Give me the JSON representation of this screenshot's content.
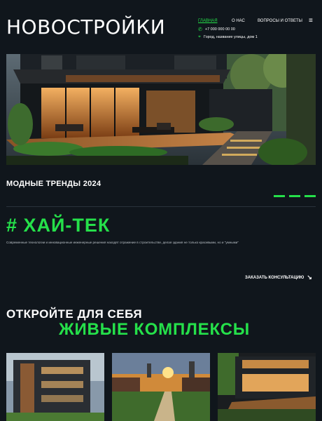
{
  "header": {
    "logo": "НОВОСТРОЙКИ",
    "nav": [
      {
        "label": "ГЛАВНАЯ",
        "active": true
      },
      {
        "label": "О НАС",
        "active": false
      },
      {
        "label": "ВОПРОСЫ И ОТВЕТЫ",
        "active": false
      }
    ],
    "menu_icon": "≡",
    "phone": "+7 000 000 00 00",
    "address": "Город, название улицы, дом 1"
  },
  "trends": {
    "title": "МОДНЫЕ ТРЕНДЫ 2024",
    "heading": "# ХАЙ-ТЕК",
    "description": "Современные технологии и инновационные инженерные решения находят отражение в строительстве, делая здания не только красивыми, но и \"умными\""
  },
  "consult_link": "ЗАКАЗАТЬ КОНСУЛЬТАЦИЮ",
  "discover": {
    "line1": "ОТКРОЙТЕ ДЛЯ СЕБЯ",
    "line2": "ЖИВЫЕ КОМПЛЕКСЫ"
  },
  "colors": {
    "accent": "#25e04a",
    "background": "#10161c"
  },
  "icons": [
    "phone-icon",
    "location-icon",
    "arrow-right-icon",
    "menu-icon"
  ]
}
